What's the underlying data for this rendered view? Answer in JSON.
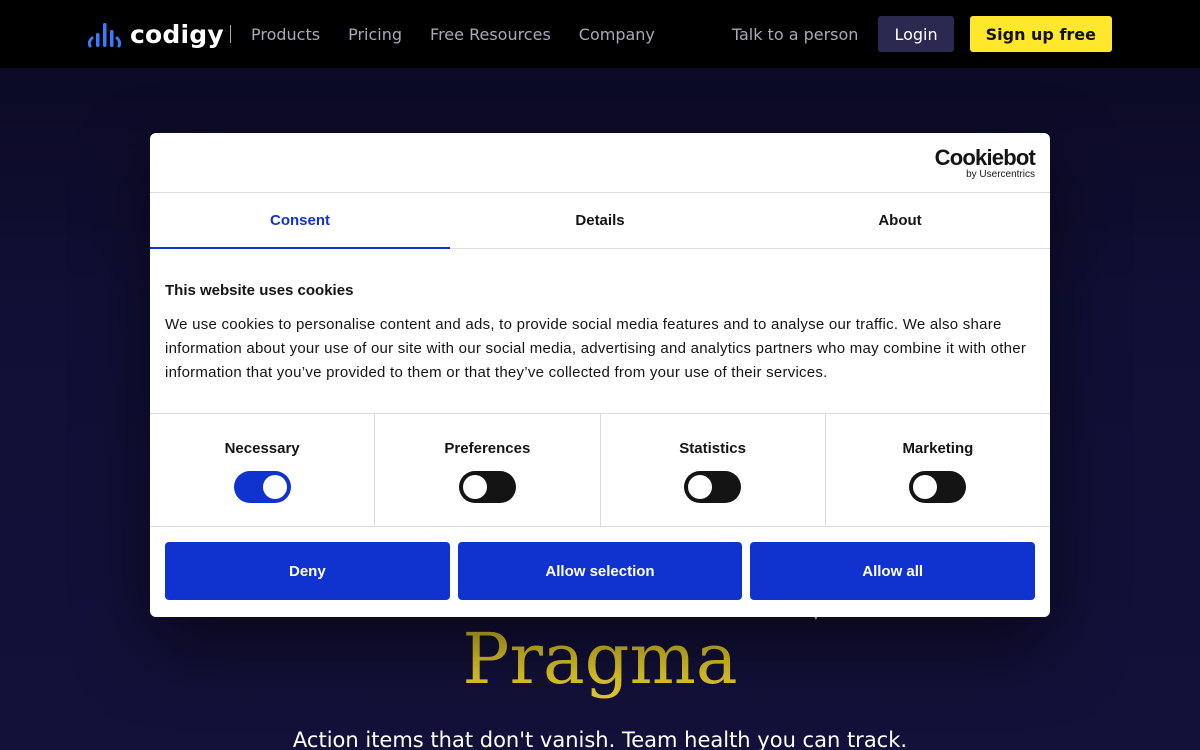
{
  "nav": {
    "logo_text": "codigy",
    "links": [
      "Products",
      "Pricing",
      "Free Resources",
      "Company"
    ],
    "talk_label": "Talk to a person",
    "login_label": "Login",
    "signup_label": "Sign up free"
  },
  "hero": {
    "title": "Pragma",
    "subtitle": "Action items that don't vanish. Team health you can track."
  },
  "cookie_dialog": {
    "brand": "Cookiebot",
    "brand_sub": "by Usercentrics",
    "tabs": [
      "Consent",
      "Details",
      "About"
    ],
    "active_tab": "Consent",
    "heading": "This website uses cookies",
    "text": "We use cookies to personalise content and ads, to provide social media features and to analyse our traffic. We also share information about your use of our site with our social media, advertising and analytics partners who may combine it with other information that you’ve provided to them or that they’ve collected from your use of their services.",
    "toggles": [
      {
        "label": "Necessary",
        "on": true
      },
      {
        "label": "Preferences",
        "on": false
      },
      {
        "label": "Statistics",
        "on": false
      },
      {
        "label": "Marketing",
        "on": false
      }
    ],
    "buttons": {
      "deny": "Deny",
      "allow_selection": "Allow selection",
      "allow_all": "Allow all"
    }
  },
  "colors": {
    "accent": "#1032cf",
    "signup": "#ffe82c",
    "hero_title": "#e4cc27",
    "nav_bg": "#000000"
  }
}
